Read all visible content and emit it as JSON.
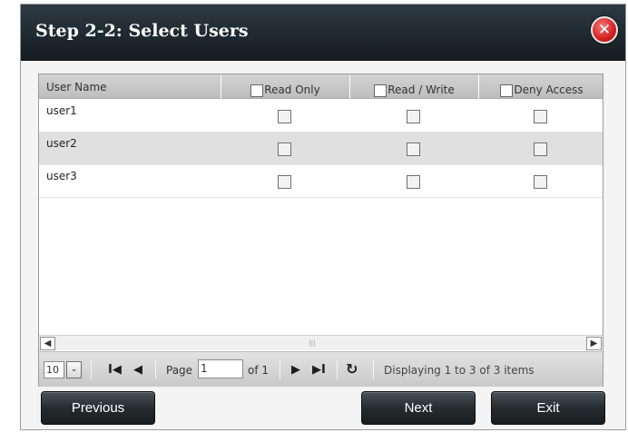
{
  "dialog": {
    "title": "Step 2-2: Select Users",
    "close_label": "✕"
  },
  "grid": {
    "columns": {
      "name": "User Name",
      "read_only": "Read Only",
      "read_write": "Read / Write",
      "deny_access": "Deny Access"
    },
    "rows": [
      {
        "user": "user1",
        "read_only": false,
        "read_write": false,
        "deny_access": false
      },
      {
        "user": "user2",
        "read_only": false,
        "read_write": false,
        "deny_access": false
      },
      {
        "user": "user3",
        "read_only": false,
        "read_write": false,
        "deny_access": false
      }
    ],
    "scroll": {
      "left_glyph": "◀",
      "right_glyph": "▶",
      "thumb_glyph": "|||"
    }
  },
  "pager": {
    "rows_per_page": "10",
    "page_label": "Page",
    "page_value": "1",
    "of_label": "of 1",
    "status": "Displaying 1 to 3 of 3 items",
    "icons": {
      "first": "I◀",
      "prev": "◀",
      "next": "▶",
      "last": "▶I",
      "refresh": "↻",
      "dropdown": "⌄"
    }
  },
  "buttons": {
    "previous": "Previous",
    "next": "Next",
    "exit": "Exit"
  }
}
